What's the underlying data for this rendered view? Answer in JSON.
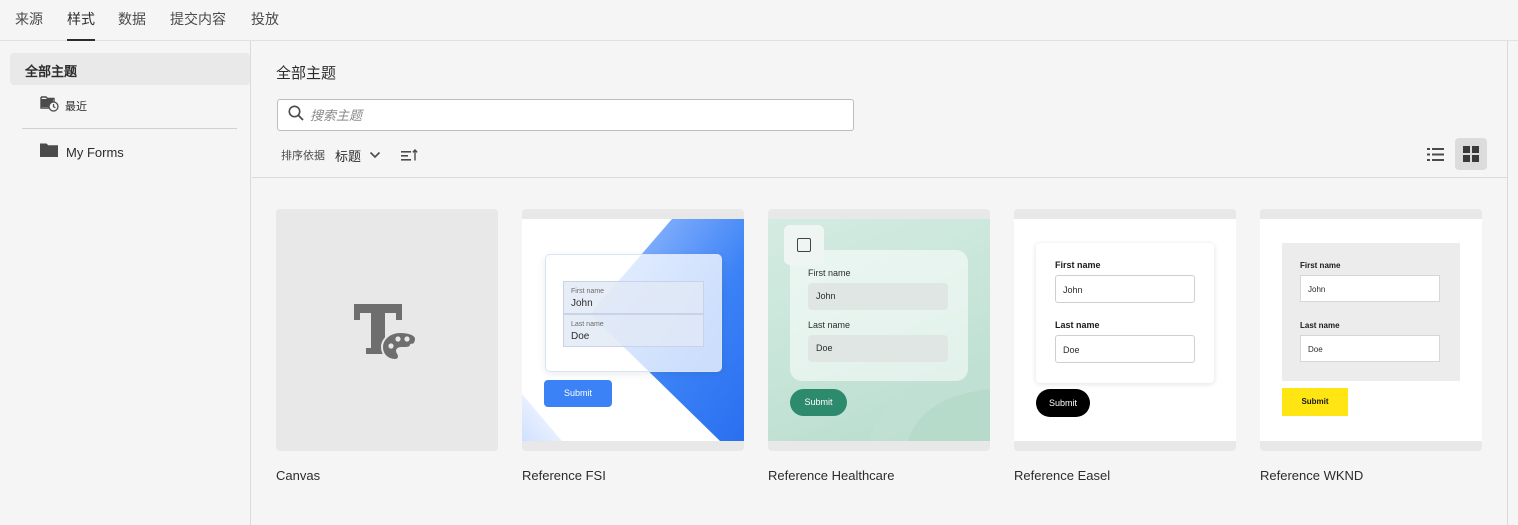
{
  "tabs": [
    {
      "label": "来源"
    },
    {
      "label": "样式"
    },
    {
      "label": "数据"
    },
    {
      "label": "提交内容"
    },
    {
      "label": "投放"
    }
  ],
  "active_tab": "样式",
  "sidebar": {
    "all_themes": "全部主题",
    "recent": {
      "label": "最近",
      "icon": "folder-recent-icon"
    },
    "my_forms": {
      "label": "My Forms",
      "icon": "folder-icon"
    }
  },
  "main": {
    "title": "全部主题",
    "search": {
      "placeholder": "搜索主题",
      "value": ""
    },
    "sort": {
      "label": "排序依据",
      "value": "标题"
    },
    "view_mode": "grid"
  },
  "cards": [
    {
      "name": "Canvas",
      "icon": "theme-palette-icon"
    },
    {
      "name": "Reference FSI",
      "first_label": "First name",
      "first_value": "John",
      "last_label": "Last name",
      "last_value": "Doe",
      "submit": "Submit",
      "accent": "#3b82f6"
    },
    {
      "name": "Reference Healthcare",
      "first_label": "First name",
      "first_value": "John",
      "last_label": "Last name",
      "last_value": "Doe",
      "submit": "Submit",
      "accent": "#2e8a6c"
    },
    {
      "name": "Reference Easel",
      "first_label": "First name",
      "first_value": "John",
      "last_label": "Last name",
      "last_value": "Doe",
      "submit": "Submit",
      "accent": "#000000"
    },
    {
      "name": "Reference WKND",
      "first_label": "First name",
      "first_value": "John",
      "last_label": "Last name",
      "last_value": "Doe",
      "submit": "Submit",
      "accent": "#ffe512"
    }
  ]
}
